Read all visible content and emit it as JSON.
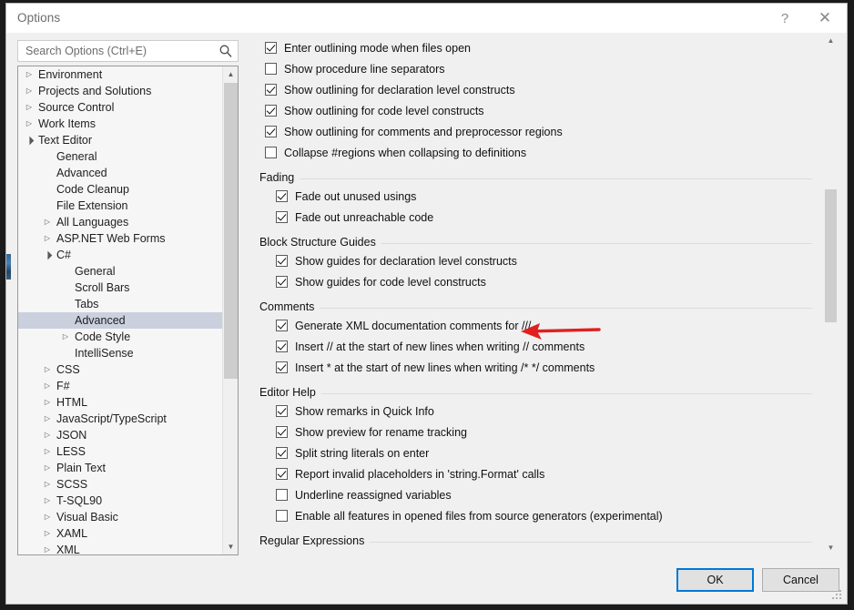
{
  "window": {
    "title": "Options",
    "help_icon": "?",
    "close_icon": "✕"
  },
  "search": {
    "placeholder": "Search Options (Ctrl+E)",
    "value": "",
    "icon": "search-icon"
  },
  "tree": {
    "items": [
      {
        "label": "Environment",
        "indent": 0,
        "arrow": "collapsed",
        "selected": false
      },
      {
        "label": "Projects and Solutions",
        "indent": 0,
        "arrow": "collapsed",
        "selected": false
      },
      {
        "label": "Source Control",
        "indent": 0,
        "arrow": "collapsed",
        "selected": false
      },
      {
        "label": "Work Items",
        "indent": 0,
        "arrow": "collapsed",
        "selected": false
      },
      {
        "label": "Text Editor",
        "indent": 0,
        "arrow": "expanded",
        "selected": false
      },
      {
        "label": "General",
        "indent": 1,
        "arrow": "none",
        "selected": false
      },
      {
        "label": "Advanced",
        "indent": 1,
        "arrow": "none",
        "selected": false
      },
      {
        "label": "Code Cleanup",
        "indent": 1,
        "arrow": "none",
        "selected": false
      },
      {
        "label": "File Extension",
        "indent": 1,
        "arrow": "none",
        "selected": false
      },
      {
        "label": "All Languages",
        "indent": 1,
        "arrow": "collapsed",
        "selected": false
      },
      {
        "label": "ASP.NET Web Forms",
        "indent": 1,
        "arrow": "collapsed",
        "selected": false
      },
      {
        "label": "C#",
        "indent": 1,
        "arrow": "expanded",
        "selected": false
      },
      {
        "label": "General",
        "indent": 2,
        "arrow": "none",
        "selected": false
      },
      {
        "label": "Scroll Bars",
        "indent": 2,
        "arrow": "none",
        "selected": false
      },
      {
        "label": "Tabs",
        "indent": 2,
        "arrow": "none",
        "selected": false
      },
      {
        "label": "Advanced",
        "indent": 2,
        "arrow": "none",
        "selected": true
      },
      {
        "label": "Code Style",
        "indent": 2,
        "arrow": "collapsed",
        "selected": false
      },
      {
        "label": "IntelliSense",
        "indent": 2,
        "arrow": "none",
        "selected": false
      },
      {
        "label": "CSS",
        "indent": 1,
        "arrow": "collapsed",
        "selected": false
      },
      {
        "label": "F#",
        "indent": 1,
        "arrow": "collapsed",
        "selected": false
      },
      {
        "label": "HTML",
        "indent": 1,
        "arrow": "collapsed",
        "selected": false
      },
      {
        "label": "JavaScript/TypeScript",
        "indent": 1,
        "arrow": "collapsed",
        "selected": false
      },
      {
        "label": "JSON",
        "indent": 1,
        "arrow": "collapsed",
        "selected": false
      },
      {
        "label": "LESS",
        "indent": 1,
        "arrow": "collapsed",
        "selected": false
      },
      {
        "label": "Plain Text",
        "indent": 1,
        "arrow": "collapsed",
        "selected": false
      },
      {
        "label": "SCSS",
        "indent": 1,
        "arrow": "collapsed",
        "selected": false
      },
      {
        "label": "T-SQL90",
        "indent": 1,
        "arrow": "collapsed",
        "selected": false
      },
      {
        "label": "Visual Basic",
        "indent": 1,
        "arrow": "collapsed",
        "selected": false
      },
      {
        "label": "XAML",
        "indent": 1,
        "arrow": "collapsed",
        "selected": false
      },
      {
        "label": "XML",
        "indent": 1,
        "arrow": "collapsed",
        "selected": false
      }
    ]
  },
  "options": {
    "outlining": [
      {
        "label": "Enter outlining mode when files open",
        "checked": true,
        "mnemonic": "o",
        "mnemonic_word": "outlining"
      },
      {
        "label": "Show procedure line separators",
        "checked": false,
        "mnemonic": "S",
        "mnemonic_word": "Show"
      },
      {
        "label": "Show outlining for declaration level constructs",
        "checked": true,
        "mnemonic": "",
        "mnemonic_word": ""
      },
      {
        "label": "Show outlining for code level constructs",
        "checked": true,
        "mnemonic": "",
        "mnemonic_word": ""
      },
      {
        "label": "Show outlining for comments and preprocessor regions",
        "checked": true,
        "mnemonic": "",
        "mnemonic_word": ""
      },
      {
        "label": "Collapse #regions when collapsing to definitions",
        "checked": false,
        "mnemonic": "",
        "mnemonic_word": ""
      }
    ],
    "groups": [
      {
        "title": "Fading",
        "items": [
          {
            "label": "Fade out unused usings",
            "checked": true
          },
          {
            "label": "Fade out unreachable code",
            "checked": true
          }
        ]
      },
      {
        "title": "Block Structure Guides",
        "items": [
          {
            "label": "Show guides for declaration level constructs",
            "checked": true
          },
          {
            "label": "Show guides for code level constructs",
            "checked": true
          }
        ]
      },
      {
        "title": "Comments",
        "items": [
          {
            "label": "Generate XML documentation comments for ///",
            "checked": true,
            "mnemonic_index": 0
          },
          {
            "label": "Insert // at the start of new lines when writing // comments",
            "checked": true,
            "mnemonic_index": 0
          },
          {
            "label": "Insert * at the start of new lines when writing /* */ comments",
            "checked": true,
            "mnemonic_index": 0
          }
        ]
      },
      {
        "title": "Editor Help",
        "items": [
          {
            "label": "Show remarks in Quick Info",
            "checked": true
          },
          {
            "label": "Show preview for rename tracking",
            "checked": true
          },
          {
            "label": "Split string literals on enter",
            "checked": true
          },
          {
            "label": "Report invalid placeholders in 'string.Format' calls",
            "checked": true
          },
          {
            "label": "Underline reassigned variables",
            "checked": false
          },
          {
            "label": "Enable all features in opened files from source generators (experimental)",
            "checked": false
          }
        ]
      }
    ],
    "truncated_group_title": "Regular Expressions"
  },
  "footer": {
    "ok_label": "OK",
    "cancel_label": "Cancel"
  },
  "annotation": {
    "type": "arrow",
    "color": "#e02020",
    "direction": "left",
    "points_at": "Generate XML documentation comments for ///"
  },
  "colors": {
    "accent": "#0078d7",
    "dialog_bg": "#f0f0f0",
    "selection": "#cbd0df",
    "annotation_red": "#e02020"
  }
}
